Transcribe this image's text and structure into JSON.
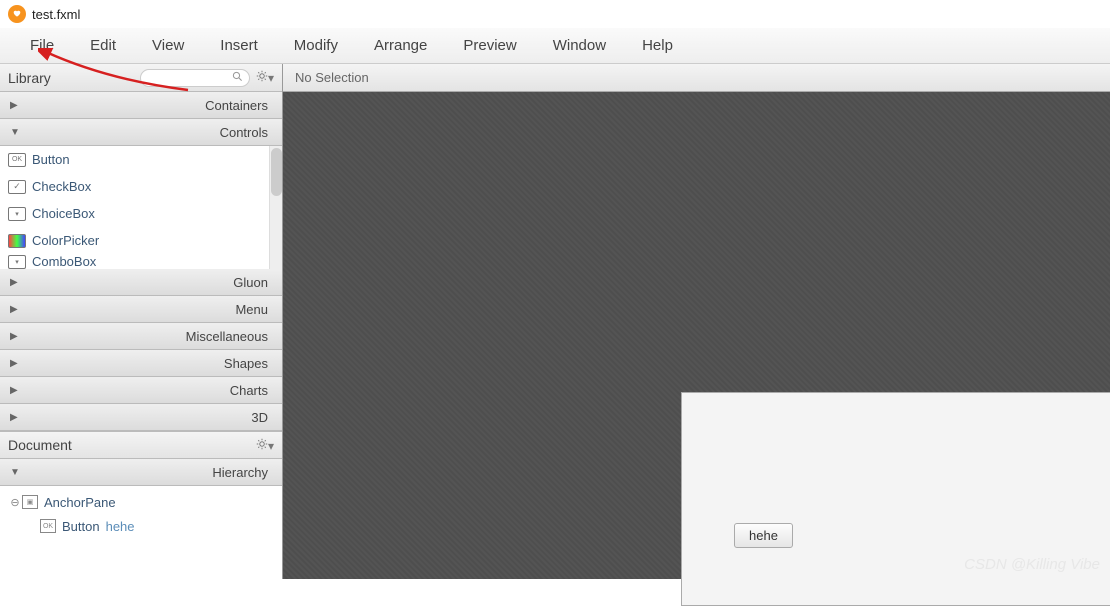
{
  "title": "test.fxml",
  "menu": [
    "File",
    "Edit",
    "View",
    "Insert",
    "Modify",
    "Arrange",
    "Preview",
    "Window",
    "Help"
  ],
  "library": {
    "title": "Library",
    "sections": [
      {
        "label": "Containers",
        "expanded": false
      },
      {
        "label": "Controls",
        "expanded": true
      },
      {
        "label": "Gluon",
        "expanded": false
      },
      {
        "label": "Menu",
        "expanded": false
      },
      {
        "label": "Miscellaneous",
        "expanded": false
      },
      {
        "label": "Shapes",
        "expanded": false
      },
      {
        "label": "Charts",
        "expanded": false
      },
      {
        "label": "3D",
        "expanded": false
      }
    ],
    "controls": [
      "Button",
      "CheckBox",
      "ChoiceBox",
      "ColorPicker",
      "ComboBox"
    ]
  },
  "document": {
    "title": "Document",
    "section": "Hierarchy",
    "tree": {
      "root": "AnchorPane",
      "child": {
        "type": "Button",
        "value": "hehe"
      }
    }
  },
  "inspector": {
    "status": "No Selection"
  },
  "design": {
    "button_label": "hehe"
  },
  "watermark": "CSDN @Killing Vibe"
}
